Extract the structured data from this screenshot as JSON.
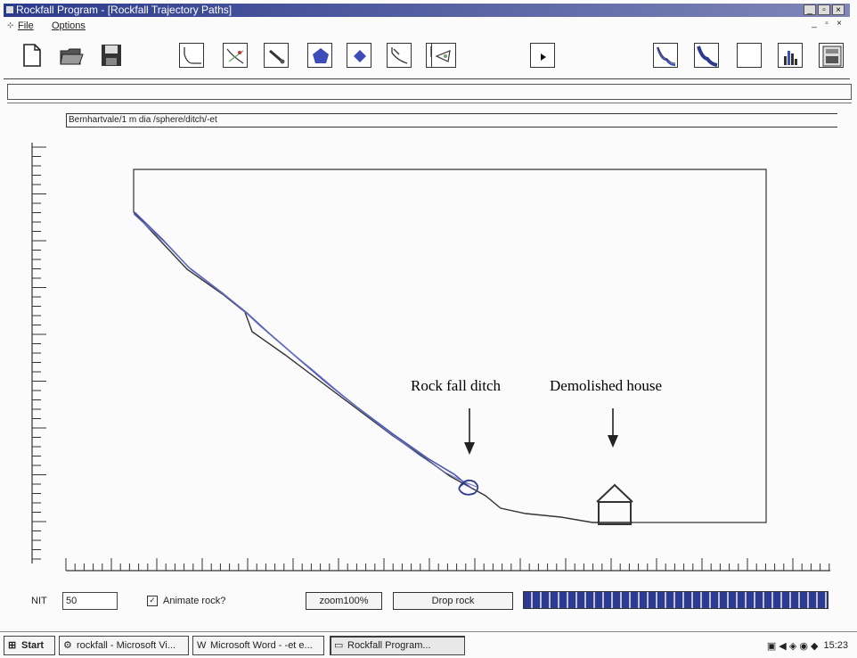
{
  "window": {
    "title": "Rockfall Program - [Rockfall Trajectory Paths]",
    "buttons": [
      "_",
      "▫",
      "×"
    ]
  },
  "menu": {
    "items": [
      "File",
      "Options"
    ],
    "mdi_buttons": [
      "_",
      "▫",
      "×"
    ]
  },
  "toolbar": {
    "buttons": [
      {
        "name": "new-file-icon"
      },
      {
        "name": "open-folder-icon"
      },
      {
        "name": "save-disk-icon"
      },
      {
        "name": "slope-profile-icon"
      },
      {
        "name": "slope-edit-icon"
      },
      {
        "name": "rock-pen-icon"
      },
      {
        "name": "pentagon-rock-icon"
      },
      {
        "name": "diamond-rock-icon"
      },
      {
        "name": "trajectory-icon"
      },
      {
        "name": "ditch-profile-icon"
      },
      {
        "name": "barrier-icon"
      },
      {
        "name": "play-icon"
      },
      {
        "name": "paths-icon"
      },
      {
        "name": "paths-bold-icon"
      },
      {
        "name": "blank-view-icon"
      },
      {
        "name": "histogram-icon"
      },
      {
        "name": "calculator-icon"
      }
    ]
  },
  "analysis": {
    "file_label": "Bernhartvale/1 m dia /sphere/ditch/-et"
  },
  "annotations": {
    "ditch": "Rock fall ditch",
    "house": "Demolished house"
  },
  "controls": {
    "niter_label": "NIT",
    "niter_value": "50",
    "animate_label": "Animate rock?",
    "animate_checked": "✓",
    "zoom_button": "zoom100%",
    "drop_button": "Drop rock",
    "progress_fraction": 1.0
  },
  "taskbar": {
    "start": "Start",
    "tasks": [
      {
        "label": "rockfall - Microsoft Vi...",
        "icon": "vb-icon"
      },
      {
        "label": "Microsoft Word - -et e...",
        "icon": "word-icon"
      },
      {
        "label": "Rockfall Program...",
        "icon": "program-icon"
      }
    ],
    "clock": "15:23"
  },
  "colors": {
    "title_bar": "#2b3a8c",
    "trajectory": "#4a55b0",
    "slope": "#333333"
  }
}
